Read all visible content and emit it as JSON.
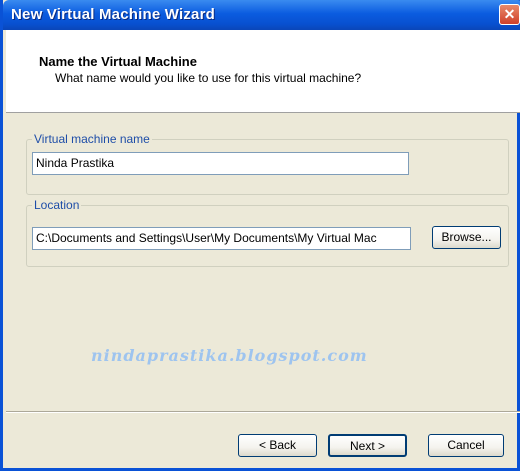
{
  "window": {
    "title": "New Virtual Machine Wizard",
    "close_label": "✕"
  },
  "header": {
    "title": "Name the Virtual Machine",
    "subtitle": "What name would you like to use for this virtual machine?"
  },
  "name_group": {
    "label": "Virtual machine name",
    "value": "Ninda Prastika"
  },
  "location_group": {
    "label": "Location",
    "value": "C:\\Documents and Settings\\User\\My Documents\\My Virtual Mac",
    "browse_label": "Browse..."
  },
  "watermark": "nindaprastika.blogspot.com",
  "footer": {
    "back_label": "< Back",
    "next_label": "Next >",
    "cancel_label": "Cancel"
  }
}
